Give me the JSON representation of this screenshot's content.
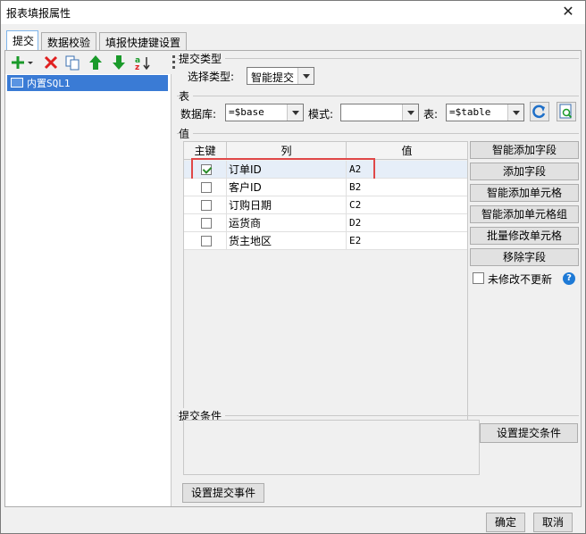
{
  "window": {
    "title": "报表填报属性",
    "close_label": "✕"
  },
  "tabs": [
    {
      "label": "提交",
      "active": true
    },
    {
      "label": "数据校验",
      "active": false
    },
    {
      "label": "填报快捷键设置",
      "active": false
    }
  ],
  "left_toolbar": {
    "icons": [
      "add-icon",
      "delete-icon",
      "copy-icon",
      "move-up-icon",
      "move-down-icon",
      "sort-icon"
    ]
  },
  "tree": {
    "items": [
      {
        "label": "内置SQL1",
        "selected": true
      }
    ]
  },
  "submit_type": {
    "group_label": "提交类型",
    "select_label": "选择类型:",
    "selected": "智能提交"
  },
  "table_group": {
    "group_label": "表",
    "database_label": "数据库:",
    "database_value": "=$base",
    "schema_label": "模式:",
    "schema_value": "",
    "table_label": "表:",
    "table_value": "=$table",
    "icons": [
      "refresh-icon",
      "preview-icon"
    ]
  },
  "value_group": {
    "group_label": "值",
    "columns": [
      "主键",
      "列",
      "值"
    ],
    "rows": [
      {
        "key": true,
        "column": "订单ID",
        "value": "A2"
      },
      {
        "key": false,
        "column": "客户ID",
        "value": "B2"
      },
      {
        "key": false,
        "column": "订购日期",
        "value": "C2"
      },
      {
        "key": false,
        "column": "运货商",
        "value": "D2"
      },
      {
        "key": false,
        "column": "货主地区",
        "value": "E2"
      }
    ],
    "buttons": [
      "智能添加字段",
      "添加字段",
      "智能添加单元格",
      "智能添加单元格组",
      "批量修改单元格",
      "移除字段"
    ],
    "no_update_label": "未修改不更新",
    "help_label": "?"
  },
  "condition_group": {
    "group_label": "提交条件",
    "set_condition_button": "设置提交条件"
  },
  "set_event_button": "设置提交事件",
  "footer": {
    "ok": "确定",
    "cancel": "取消"
  },
  "colors": {
    "selection": "#3a7bd5",
    "highlight_border": "#e04848",
    "help": "#1e7ad6"
  }
}
